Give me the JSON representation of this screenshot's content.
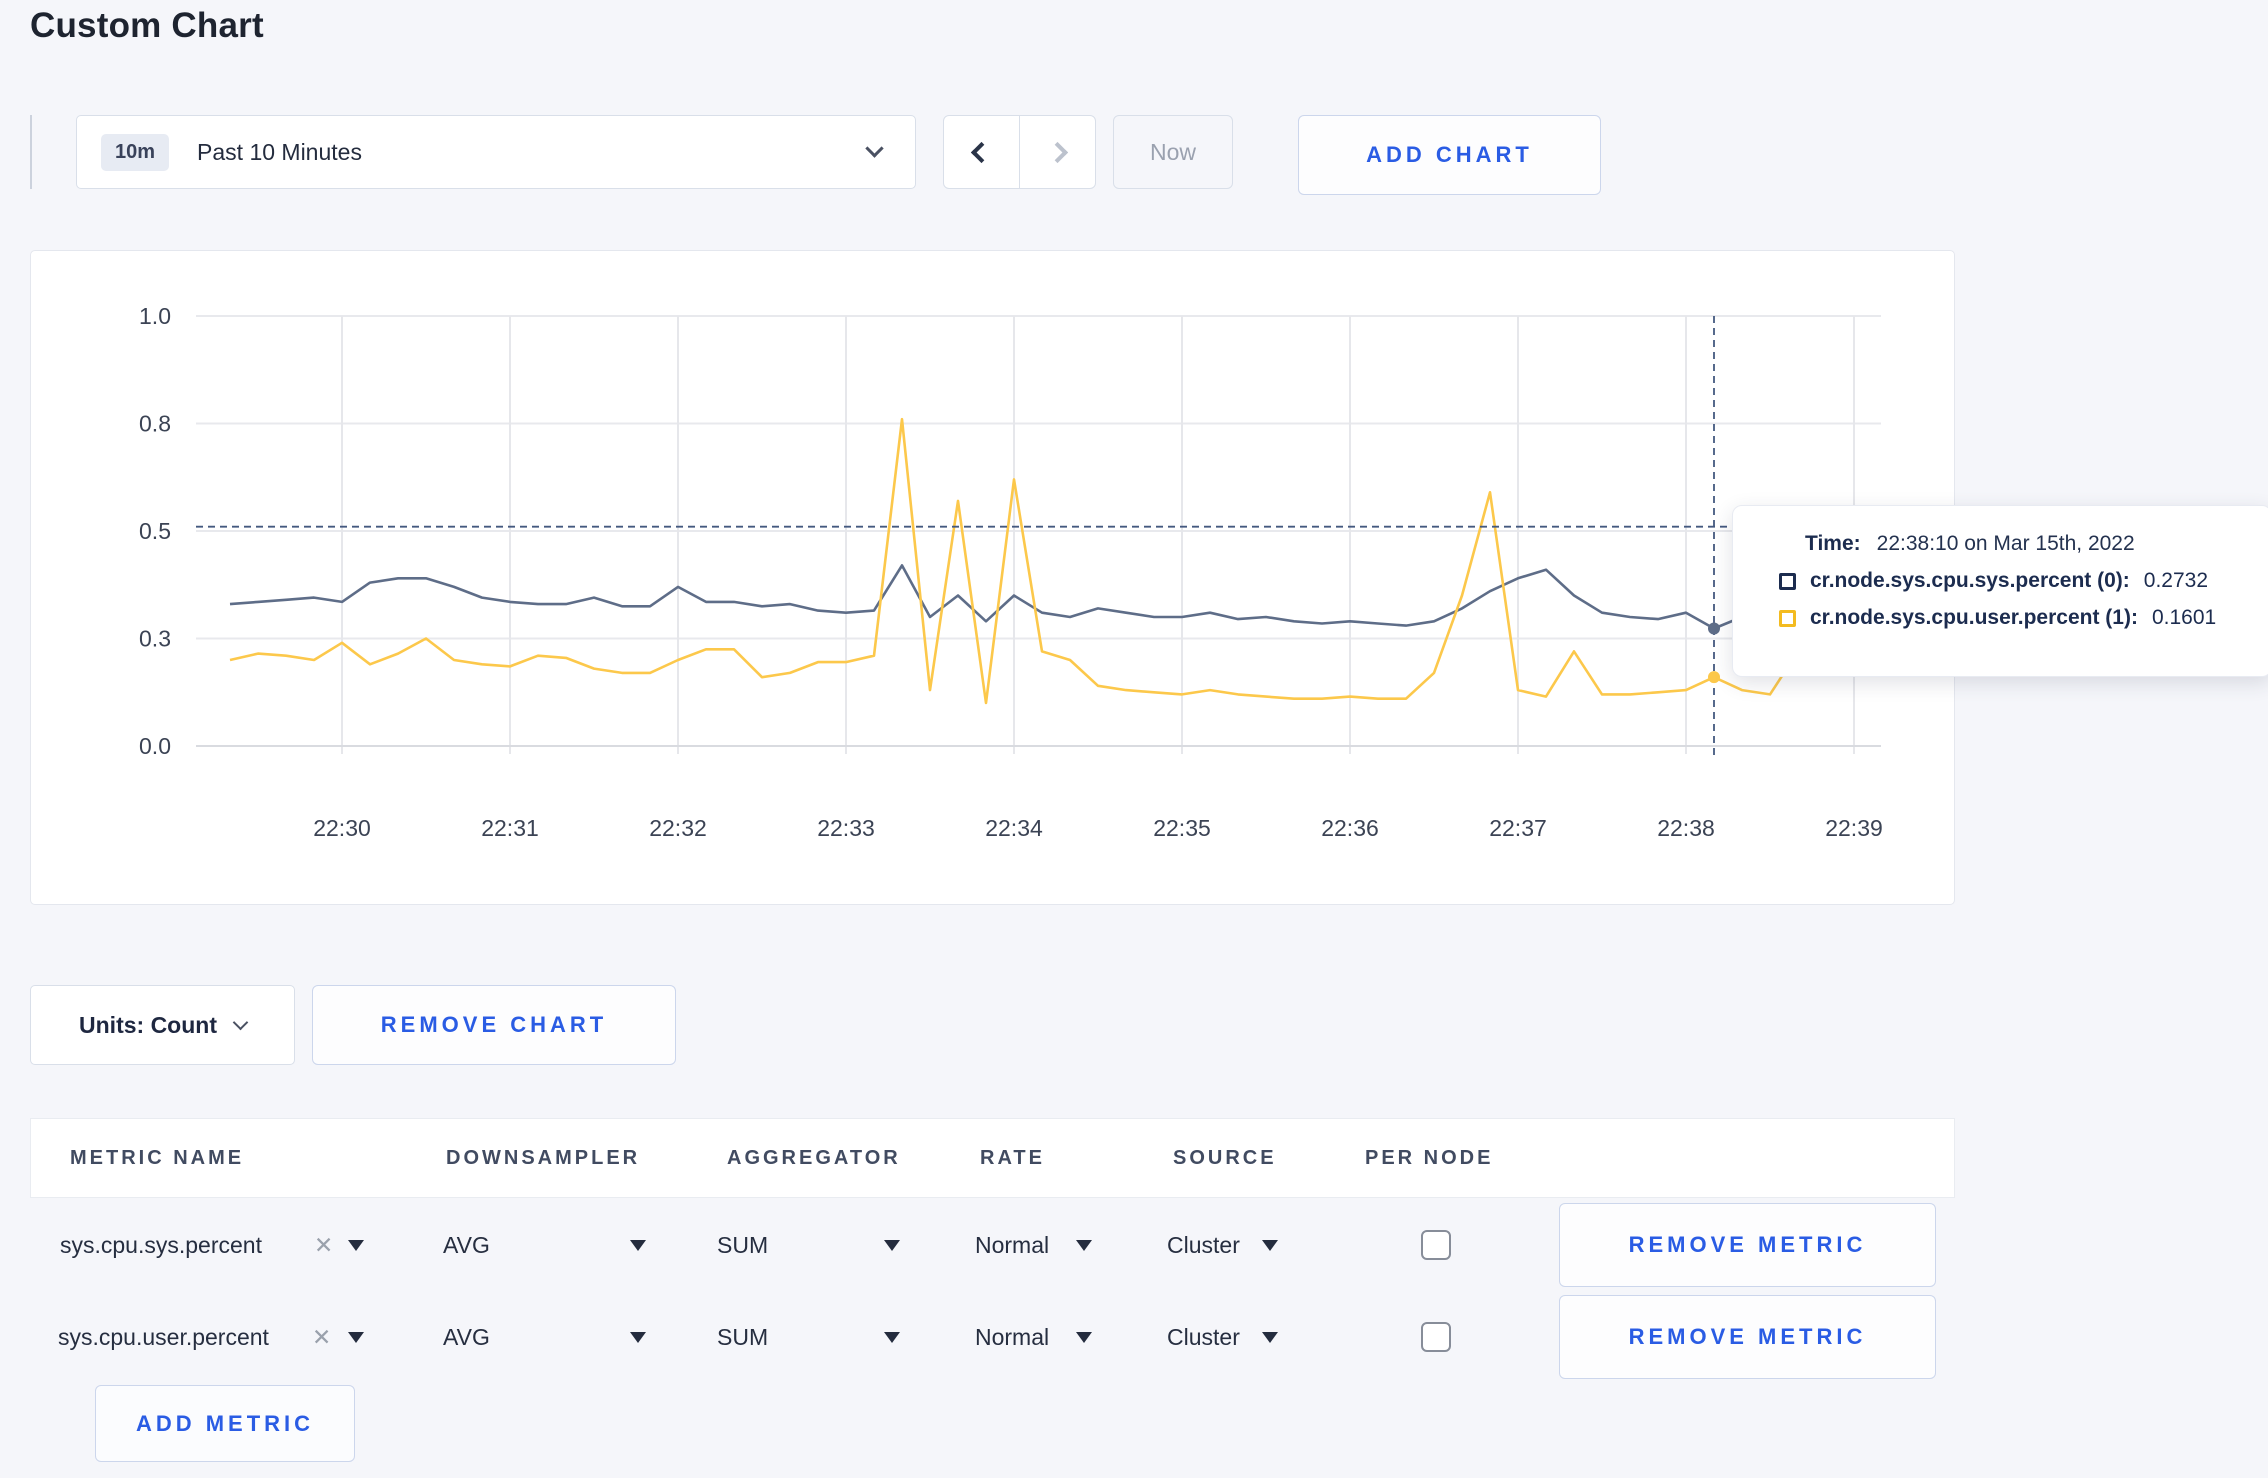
{
  "page": {
    "title": "Custom Chart",
    "background": "#f5f6fa"
  },
  "toolbar": {
    "time_range": {
      "badge": "10m",
      "label": "Past 10 Minutes"
    },
    "now_label": "Now",
    "add_chart_label": "ADD CHART"
  },
  "icons": {
    "clear": "✕"
  },
  "chart_data": {
    "type": "line",
    "title": "",
    "xlabel": "",
    "ylabel": "",
    "ylim": [
      0,
      1
    ],
    "grid": true,
    "y_ticks": [
      {
        "value": 0.0,
        "label": "0.0"
      },
      {
        "value": 0.25,
        "label": "0.3"
      },
      {
        "value": 0.5,
        "label": "0.5"
      },
      {
        "value": 0.75,
        "label": "0.8"
      },
      {
        "value": 1.0,
        "label": "1.0"
      }
    ],
    "x_tick_labels": [
      "22:30",
      "22:31",
      "22:32",
      "22:33",
      "22:34",
      "22:35",
      "22:36",
      "22:37",
      "22:38",
      "22:39"
    ],
    "x_start": "22:29:20",
    "x_step_seconds": 10,
    "series": [
      {
        "name": "cr.node.sys.cpu.sys.percent",
        "color": "#5e6d88",
        "values": [
          0.33,
          0.335,
          0.34,
          0.345,
          0.335,
          0.38,
          0.39,
          0.39,
          0.37,
          0.345,
          0.335,
          0.33,
          0.33,
          0.345,
          0.325,
          0.325,
          0.37,
          0.335,
          0.335,
          0.325,
          0.33,
          0.315,
          0.31,
          0.315,
          0.42,
          0.3,
          0.35,
          0.29,
          0.35,
          0.31,
          0.3,
          0.32,
          0.31,
          0.3,
          0.3,
          0.31,
          0.295,
          0.3,
          0.29,
          0.285,
          0.29,
          0.285,
          0.28,
          0.29,
          0.32,
          0.36,
          0.39,
          0.41,
          0.35,
          0.31,
          0.3,
          0.295,
          0.31,
          0.2732,
          0.3,
          0.295,
          0.3,
          0.305,
          0.3,
          0.3
        ]
      },
      {
        "name": "cr.node.sys.cpu.user.percent",
        "color": "#fcc84b",
        "values": [
          0.2,
          0.215,
          0.21,
          0.2,
          0.24,
          0.19,
          0.215,
          0.25,
          0.2,
          0.19,
          0.185,
          0.21,
          0.205,
          0.18,
          0.17,
          0.17,
          0.2,
          0.225,
          0.225,
          0.16,
          0.17,
          0.195,
          0.195,
          0.21,
          0.76,
          0.13,
          0.57,
          0.1,
          0.62,
          0.22,
          0.2,
          0.14,
          0.13,
          0.125,
          0.12,
          0.13,
          0.12,
          0.115,
          0.11,
          0.11,
          0.115,
          0.11,
          0.11,
          0.17,
          0.35,
          0.59,
          0.13,
          0.115,
          0.22,
          0.12,
          0.12,
          0.125,
          0.13,
          0.1601,
          0.13,
          0.12,
          0.22,
          0.26,
          0.25,
          0.22
        ]
      }
    ],
    "crosshair": {
      "x_index": 53,
      "y_value": 0.51,
      "color": "#44597f"
    },
    "legend_position": "tooltip"
  },
  "tooltip": {
    "time_prefix": "Time:",
    "time_value": "22:38:10 on Mar 15th, 2022",
    "rows": [
      {
        "label": "cr.node.sys.cpu.sys.percent (0):",
        "value": "0.2732",
        "swatch_color": "#1c2c4f"
      },
      {
        "label": "cr.node.sys.cpu.user.percent (1):",
        "value": "0.1601",
        "swatch_color": "#f3bb20"
      }
    ]
  },
  "chart_footer": {
    "units_label": "Units: Count",
    "remove_chart_label": "REMOVE CHART"
  },
  "metrics_table": {
    "headers": [
      "METRIC NAME",
      "DOWNSAMPLER",
      "AGGREGATOR",
      "RATE",
      "SOURCE",
      "PER NODE"
    ],
    "rows": [
      {
        "metric": "sys.cpu.sys.percent",
        "downsampler": "AVG",
        "aggregator": "SUM",
        "rate": "Normal",
        "source": "Cluster",
        "per_node_checked": false,
        "remove_label": "REMOVE METRIC"
      },
      {
        "metric": "sys.cpu.user.percent",
        "downsampler": "AVG",
        "aggregator": "SUM",
        "rate": "Normal",
        "source": "Cluster",
        "per_node_checked": false,
        "remove_label": "REMOVE METRIC"
      }
    ],
    "add_metric_label": "ADD METRIC"
  }
}
